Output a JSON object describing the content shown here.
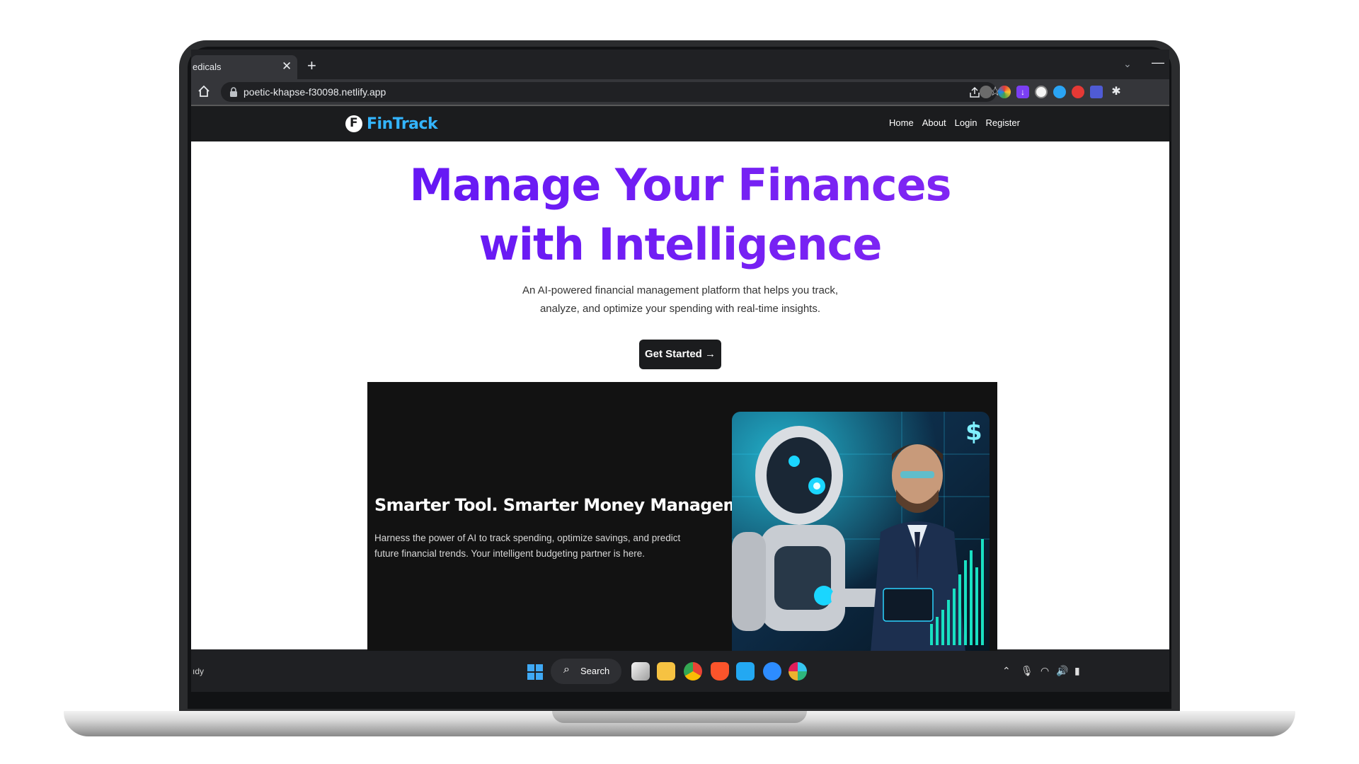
{
  "browser": {
    "tab_title": "edicals",
    "tab_close": "✕",
    "new_tab": "+",
    "url": "poetic-khapse-f30098.netlify.app"
  },
  "site": {
    "brand": "FinTrack",
    "nav": [
      "Home",
      "About",
      "Login",
      "Register"
    ],
    "hero_title_line1": "Manage Your Finances",
    "hero_title_line2": "with Intelligence",
    "hero_sub_line1": "An AI-powered financial management platform that helps you track,",
    "hero_sub_line2": "analyze, and optimize your spending with real-time insights.",
    "cta": "Get Started →",
    "feature_title": "Smarter Tool. Smarter Money Management.",
    "feature_desc": "Harness the power of AI to track spending, optimize savings, and predict future financial trends. Your intelligent budgeting partner is here."
  },
  "taskbar": {
    "left_text": "ıdy",
    "search_label": "Search"
  },
  "colors": {
    "brand": "#33b5ff",
    "hero_gradient_start": "#5b12f5",
    "hero_gradient_end": "#8a2cf2",
    "navbar": "#1b1c1e"
  }
}
